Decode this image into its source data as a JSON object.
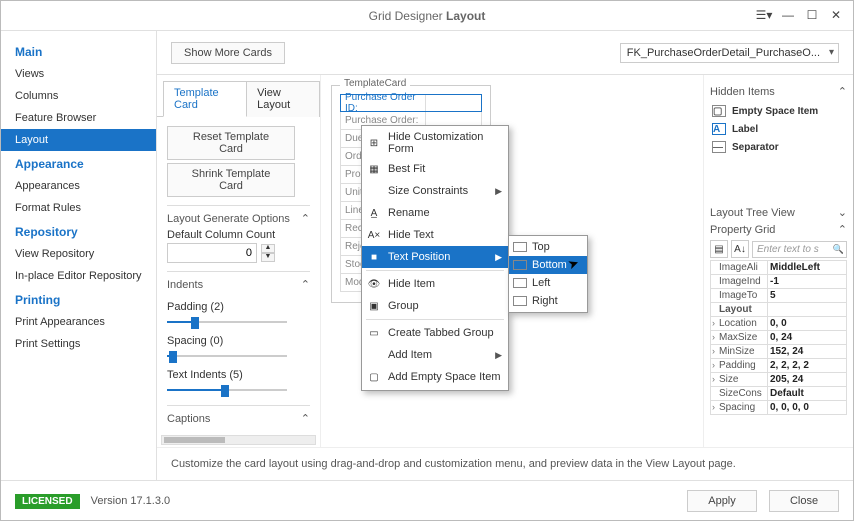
{
  "title_prefix": "Grid Designer",
  "title_main": "Layout",
  "topbar": {
    "show_more": "Show More Cards",
    "dropdown_value": "FK_PurchaseOrderDetail_PurchaseO..."
  },
  "sidebar": {
    "cats": [
      {
        "name": "Main",
        "items": [
          "Views",
          "Columns",
          "Feature Browser",
          "Layout"
        ],
        "selected": 3
      },
      {
        "name": "Appearance",
        "items": [
          "Appearances",
          "Format Rules"
        ]
      },
      {
        "name": "Repository",
        "items": [
          "View Repository",
          "In-place Editor Repository"
        ]
      },
      {
        "name": "Printing",
        "items": [
          "Print Appearances",
          "Print Settings"
        ]
      }
    ]
  },
  "tabs": {
    "a": "Template Card",
    "b": "View Layout"
  },
  "left": {
    "reset": "Reset Template Card",
    "shrink": "Shrink Template Card",
    "gen_head": "Layout Generate Options",
    "default_col": "Default Column Count",
    "default_col_val": "0",
    "indents": "Indents",
    "padding": "Padding (2)",
    "spacing": "Spacing (0)",
    "textindents": "Text Indents (5)",
    "captions": "Captions"
  },
  "card": {
    "legend": "TemplateCard",
    "rows": [
      "Purchase Order ID:",
      "Purchase Order:",
      "Due Date:",
      "Order Qty:",
      "Product ID:",
      "Unit Price:",
      "Line Total:",
      "Received Qty:",
      "Rejected Qty:",
      "Stocked Qty:",
      "Modified Date:"
    ]
  },
  "menu": {
    "items": [
      {
        "icon": "⊞",
        "label": "Hide Customization Form"
      },
      {
        "icon": "▦",
        "label": "Best Fit"
      },
      {
        "icon": "",
        "label": "Size Constraints",
        "sub": true
      },
      {
        "icon": "A̲",
        "label": "Rename"
      },
      {
        "icon": "A×",
        "label": "Hide Text"
      },
      {
        "icon": "■",
        "label": "Text Position",
        "sub": true,
        "hover": true
      },
      {
        "icon": "👁",
        "label": "Hide Item"
      },
      {
        "icon": "▣",
        "label": "Group"
      },
      {
        "icon": "▭",
        "label": "Create Tabbed Group"
      },
      {
        "icon": "",
        "label": "Add Item",
        "sub": true
      },
      {
        "icon": "▢",
        "label": "Add Empty Space Item"
      }
    ],
    "sub": [
      "Top",
      "Bottom",
      "Left",
      "Right"
    ],
    "sub_hover": 1
  },
  "right": {
    "hidden_head": "Hidden Items",
    "hidden": [
      {
        "icon": "▢",
        "label": "Empty Space Item"
      },
      {
        "icon": "A",
        "label": "Label",
        "color": "#1a73c7"
      },
      {
        "icon": "—",
        "label": "Separator"
      }
    ],
    "layout_tree": "Layout Tree View",
    "prop_grid": "Property Grid",
    "search_placeholder": "Enter text to s",
    "props": [
      {
        "k": "ImageAli",
        "v": "MiddleLeft"
      },
      {
        "k": "ImageInd",
        "v": "-1"
      },
      {
        "k": "ImageTo",
        "v": "5"
      },
      {
        "k": "Layout",
        "v": "",
        "cat": true
      },
      {
        "k": "Location",
        "v": "0, 0",
        "ind": true
      },
      {
        "k": "MaxSize",
        "v": "0, 24",
        "ind": true
      },
      {
        "k": "MinSize",
        "v": "152, 24",
        "ind": true
      },
      {
        "k": "Padding",
        "v": "2, 2, 2, 2",
        "ind": true
      },
      {
        "k": "Size",
        "v": "205, 24",
        "ind": true
      },
      {
        "k": "SizeCons",
        "v": "Default"
      },
      {
        "k": "Spacing",
        "v": "0, 0, 0, 0",
        "ind": true
      }
    ]
  },
  "msg": "Customize the card layout using drag-and-drop and customization menu, and preview data in the View Layout page.",
  "footer": {
    "badge": "LICENSED",
    "version": "Version 17.1.3.0",
    "apply": "Apply",
    "close": "Close"
  }
}
